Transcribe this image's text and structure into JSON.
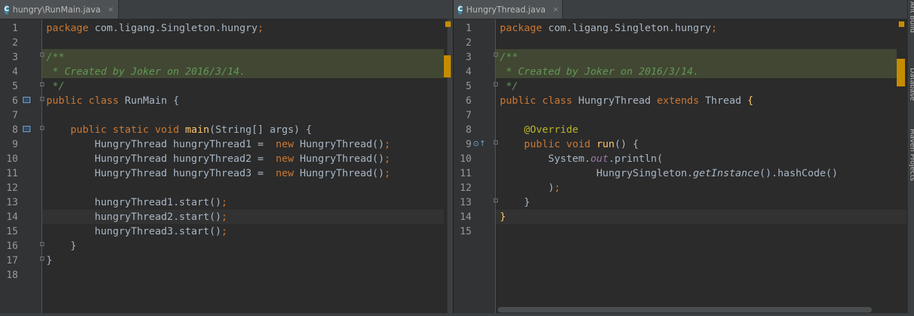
{
  "left": {
    "tab": {
      "icon": "C",
      "label": "hungry\\RunMain.java",
      "close": "×"
    },
    "lines": [
      {
        "n": "1",
        "html": "<span class=\"k\">package</span> com.ligang.Singleton.hungry<span class=\"k\">;</span>"
      },
      {
        "n": "2",
        "html": ""
      },
      {
        "n": "3",
        "html": "<span class=\"c\">/**</span>"
      },
      {
        "n": "4",
        "html": "<span class=\"c\"> * Created by Joker on 2016/3/14.</span>"
      },
      {
        "n": "5",
        "html": "<span class=\"c\"> */</span>"
      },
      {
        "n": "6",
        "html": "<span class=\"k\">public class</span> RunMain {"
      },
      {
        "n": "7",
        "html": ""
      },
      {
        "n": "8",
        "html": "    <span class=\"k\">public static void</span> <span class=\"fn\">main</span>(String[] args) {"
      },
      {
        "n": "9",
        "html": "        HungryThread hungryThread1 =  <span class=\"k\">new</span> HungryThread()<span class=\"k\">;</span>"
      },
      {
        "n": "10",
        "html": "        HungryThread hungryThread2 =  <span class=\"k\">new</span> HungryThread()<span class=\"k\">;</span>"
      },
      {
        "n": "11",
        "html": "        HungryThread hungryThread3 =  <span class=\"k\">new</span> HungryThread()<span class=\"k\">;</span>"
      },
      {
        "n": "12",
        "html": ""
      },
      {
        "n": "13",
        "html": "        hungryThread1.start()<span class=\"k\">;</span>"
      },
      {
        "n": "14",
        "html": "        hungryThread2.start()<span class=\"k\">;</span>"
      },
      {
        "n": "15",
        "html": "        hungryThread3.start()<span class=\"k\">;</span>"
      },
      {
        "n": "16",
        "html": "    }"
      },
      {
        "n": "17",
        "html": "}"
      },
      {
        "n": "18",
        "html": ""
      }
    ]
  },
  "right": {
    "tab": {
      "icon": "C",
      "label": "HungryThread.java",
      "close": "×"
    },
    "lines": [
      {
        "n": "1",
        "html": "<span class=\"k\">package</span> com.ligang.Singleton.hungry<span class=\"k\">;</span>"
      },
      {
        "n": "2",
        "html": ""
      },
      {
        "n": "3",
        "html": "<span class=\"c\">/**</span>"
      },
      {
        "n": "4",
        "html": "<span class=\"c\"> * Created by Joker on 2016/3/14.</span>"
      },
      {
        "n": "5",
        "html": "<span class=\"c\"> */</span>"
      },
      {
        "n": "6",
        "html": "<span class=\"k\">public class</span> HungryThread <span class=\"k\">extends</span> Thread <span class=\"fn\">{</span>"
      },
      {
        "n": "7",
        "html": ""
      },
      {
        "n": "8",
        "html": "    <span class=\"an\">@Override</span>"
      },
      {
        "n": "9",
        "html": "    <span class=\"k\">public void</span> <span class=\"fn\">run</span>() {"
      },
      {
        "n": "10",
        "html": "        System.<span class=\"st\">out</span>.println("
      },
      {
        "n": "11",
        "html": "                HungrySingleton.<span class=\"it\">getInstance</span>().hashCode()"
      },
      {
        "n": "12",
        "html": "        )<span class=\"k\">;</span>"
      },
      {
        "n": "13",
        "html": "    }"
      },
      {
        "n": "14",
        "html": "<span class=\"fn\">}</span>"
      },
      {
        "n": "15",
        "html": ""
      }
    ]
  },
  "sidebar": {
    "labels": [
      "Ant Build",
      "Database",
      "Maven Projects"
    ]
  },
  "colors": {
    "background": "#2B2B2B",
    "keyword": "#CC7832",
    "comment": "#629755",
    "function": "#FFC66D",
    "annotation": "#BBB529",
    "static_field": "#9876AA",
    "text": "#A9B7C6"
  }
}
